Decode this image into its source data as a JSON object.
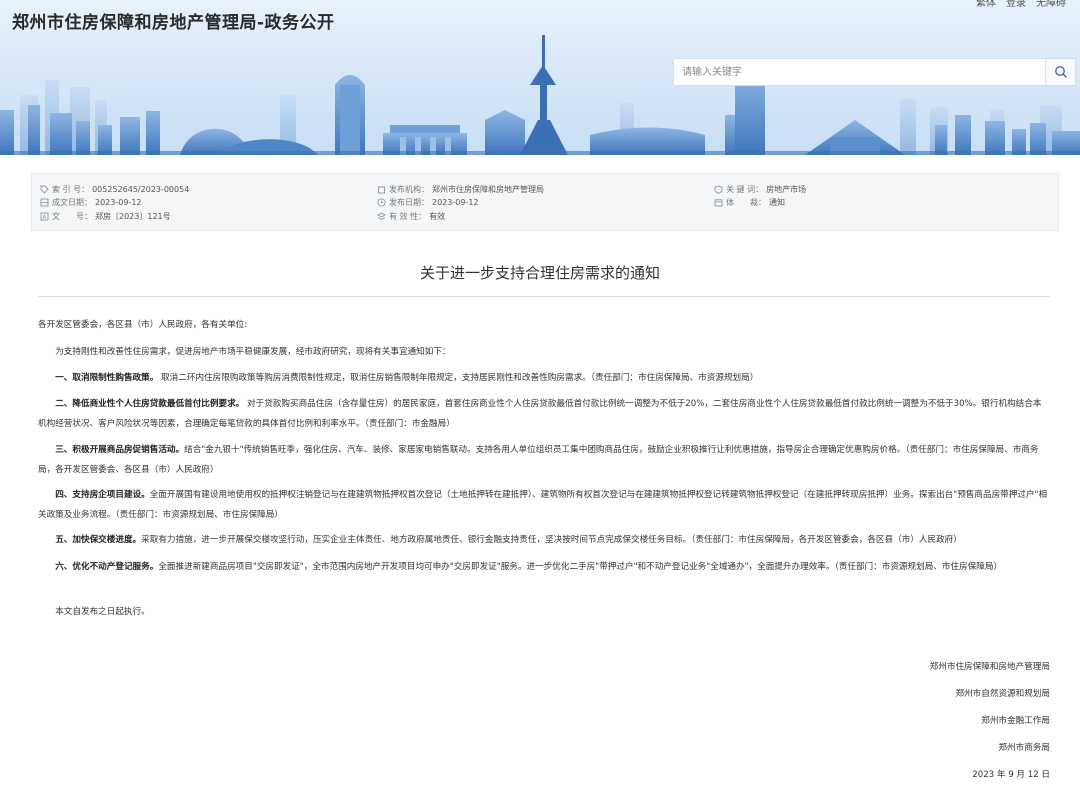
{
  "header": {
    "site_title": "郑州市住房保障和房地产管理局-政务公开",
    "top_links": [
      "繁体",
      "登录",
      "无障碍"
    ],
    "search_placeholder": "请输入关键字"
  },
  "info": {
    "index_label": "索 引 号：",
    "index_value": "005252645/2023-00054",
    "publisher_label": "发布机构：",
    "publisher_value": "郑州市住房保障和房地产管理局",
    "keyword_label": "关 键 词：",
    "keyword_value": "房地产市场",
    "created_label": "成文日期：",
    "created_value": "2023-09-12",
    "pubdate_label": "发布日期：",
    "pubdate_value": "2023-09-12",
    "genre_label": "体　　裁：",
    "genre_value": "通知",
    "docno_label": "文　　号：",
    "docno_value": "郑房〔2023〕121号",
    "validity_label": "有 效 性：",
    "validity_value": "有效"
  },
  "document": {
    "title": "关于进一步支持合理住房需求的通知",
    "salutation": "各开发区管委会，各区县（市）人民政府，各有关单位:",
    "intro": "为支持刚性和改善性住房需求，促进房地产市场平稳健康发展，经市政府研究，现将有关事宜通知如下：",
    "items": [
      {
        "head": "一、取消限制性购售政策。",
        "text": "取消二环内住房限购政策等购房消费限制性规定，取消住房销售限制年限规定，支持居民刚性和改善性购房需求。（责任部门：市住房保障局、市资源规划局）"
      },
      {
        "head": "二、降低商业性个人住房贷款最低首付比例要求。",
        "text": "对于贷款购买商品住房（含存量住房）的居民家庭，首套住房商业性个人住房贷款最低首付款比例统一调整为不低于20%，二套住房商业性个人住房贷款最低首付款比例统一调整为不低于30%。银行机构结合本机构经营状况、客户风险状况等因素，合理确定每笔贷款的具体首付比例和利率水平。（责任部门：市金融局）"
      },
      {
        "head": "三、积极开展商品房促销售活动。",
        "text": "结合\"金九银十\"传统销售旺季，强化住房、汽车、装修、家居家电销售联动。支持各用人单位组织员工集中团购商品住房，鼓励企业积极推行让利优惠措施，指导房企合理确定优惠购房价格。（责任部门：市住房保障局、市商务局，各开发区管委会、各区县（市）人民政府）"
      },
      {
        "head": "四、支持房企项目建设。",
        "text": "全面开展国有建设用地使用权的抵押权注销登记与在建建筑物抵押权首次登记（土地抵押转在建抵押）、建筑物所有权首次登记与在建建筑物抵押权登记转建筑物抵押权登记（在建抵押转现房抵押）业务。探索出台\"预售商品房带押过户\"相关政策及业务流程。（责任部门：市资源规划局、市住房保障局）"
      },
      {
        "head": "五、加快保交楼进度。",
        "text": "采取有力措施，进一步开展保交楼攻坚行动，压实企业主体责任、地方政府属地责任、银行金融支持责任，坚决按时间节点完成保交楼任务目标。（责任部门：市住房保障局，各开发区管委会，各区县（市）人民政府）"
      },
      {
        "head": "六、优化不动产登记服务。",
        "text": "全面推进新建商品房项目\"交房即发证\"，全市范围内房地产开发项目均可申办\"交房即发证\"服务。进一步优化二手房\"带押过户\"和不动产登记业务\"全域通办\"，全面提升办理效率。（责任部门：市资源规划局、市住房保障局）"
      }
    ],
    "closing": "本文自发布之日起执行。",
    "signatures": [
      "郑州市住房保障和房地产管理局",
      "郑州市自然资源和规划局",
      "郑州市金融工作局",
      "郑州市商务局"
    ],
    "date": "2023 年 9 月 12 日"
  },
  "colors": {
    "banner_top": "#e9f2fb",
    "banner_bottom": "#c7def4",
    "skyline": "#5b8fc9",
    "panel_bg": "#f4f6f8"
  },
  "icons": [
    "search-icon",
    "tag-icon",
    "building-icon",
    "shield-icon",
    "calendar-icon",
    "clock-icon",
    "doc-icon",
    "layers-icon",
    "grid-icon"
  ]
}
